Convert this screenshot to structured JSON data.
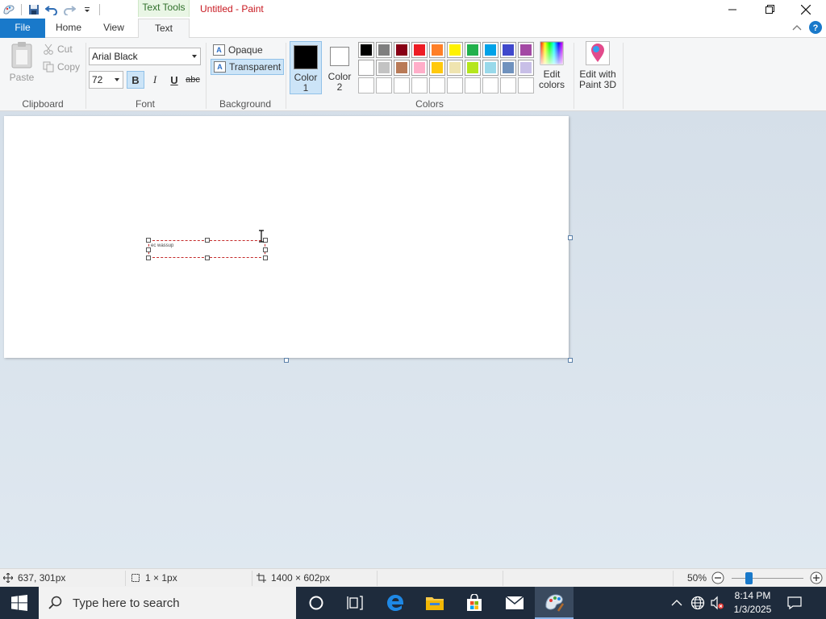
{
  "titlebar": {
    "context_tab": "Text Tools",
    "title": "Untitled - Paint"
  },
  "tabs": {
    "file": "File",
    "home": "Home",
    "view": "View",
    "text": "Text"
  },
  "ribbon": {
    "clipboard": {
      "label": "Clipboard",
      "paste": "Paste",
      "cut": "Cut",
      "copy": "Copy"
    },
    "font": {
      "label": "Font",
      "family": "Arial Black",
      "size": "72",
      "bold": "B",
      "italic": "I",
      "underline": "U",
      "strike": "abc"
    },
    "background": {
      "label": "Background",
      "opaque": "Opaque",
      "transparent": "Transparent"
    },
    "colors": {
      "label": "Colors",
      "color1_label": "Color",
      "color1_num": "1",
      "color2_label": "Color",
      "color2_num": "2",
      "color1": "#000000",
      "color2": "#ffffff",
      "edit_colors_line1": "Edit",
      "edit_colors_line2": "colors",
      "paint3d_line1": "Edit with",
      "paint3d_line2": "Paint 3D",
      "palette": [
        "#000000",
        "#7f7f7f",
        "#880015",
        "#ed1c24",
        "#ff7f27",
        "#fff200",
        "#22b14c",
        "#00a2e8",
        "#3f48cc",
        "#a349a4",
        "#ffffff",
        "#c3c3c3",
        "#b97a57",
        "#ffaec9",
        "#ffc90e",
        "#efe4b0",
        "#b5e61d",
        "#99d9ea",
        "#7092be",
        "#c8bfe7",
        "#ffffff",
        "#ffffff",
        "#ffffff",
        "#ffffff",
        "#ffffff",
        "#ffffff",
        "#ffffff",
        "#ffffff",
        "#ffffff",
        "#ffffff"
      ]
    }
  },
  "canvas": {
    "text_content": "ec wassup"
  },
  "status": {
    "cursor_pos": "637, 301px",
    "selection_size": "1 × 1px",
    "image_size": "1400 × 602px",
    "zoom": "50%"
  },
  "taskbar": {
    "search_placeholder": "Type here to search",
    "time": "8:14 PM",
    "date": "1/3/2025"
  }
}
